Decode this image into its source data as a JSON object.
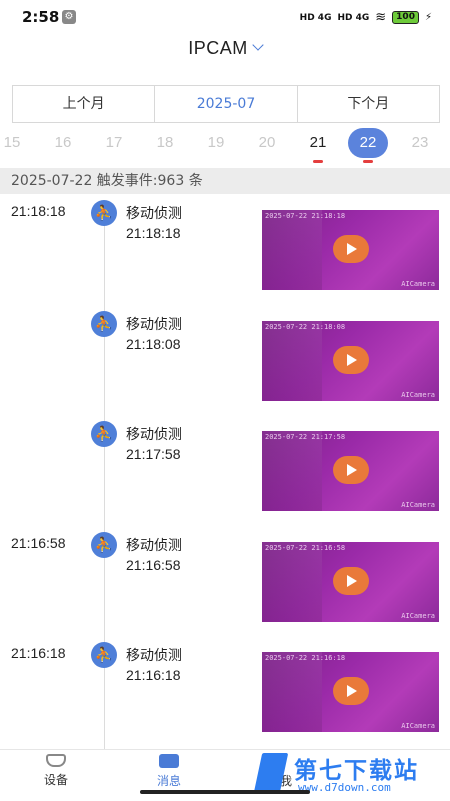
{
  "status_bar": {
    "time": "2:58",
    "wrench": "🔧",
    "net1": "HD 4G",
    "net2": "HD 4G",
    "battery": "100"
  },
  "header": {
    "title": "IPCAM"
  },
  "month_nav": {
    "prev": "上个月",
    "current": "2025-07",
    "next": "下个月"
  },
  "days": [
    "15",
    "16",
    "17",
    "18",
    "19",
    "20",
    "21",
    "22",
    "23"
  ],
  "selected_day": "22",
  "date_summary": "2025-07-22 触发事件:963 条",
  "events": [
    {
      "time": "21:18:18",
      "type": "移动侦测",
      "detail": "21:18:18",
      "stamp": "2025-07-22 21:18:18",
      "brand": "AICamera"
    },
    {
      "time": "",
      "type": "移动侦测",
      "detail": "21:18:08",
      "stamp": "2025-07-22 21:18:08",
      "brand": "AICamera"
    },
    {
      "time": "",
      "type": "移动侦测",
      "detail": "21:17:58",
      "stamp": "2025-07-22 21:17:58",
      "brand": "AICamera"
    },
    {
      "time": "21:16:58",
      "type": "移动侦测",
      "detail": "21:16:58",
      "stamp": "2025-07-22 21:16:58",
      "brand": "AICamera"
    },
    {
      "time": "21:16:18",
      "type": "移动侦测",
      "detail": "21:16:18",
      "stamp": "2025-07-22 21:16:18",
      "brand": "AICamera"
    }
  ],
  "bottom_nav": {
    "device": "设备",
    "message": "消息",
    "mine": "我"
  },
  "watermark": {
    "title": "第七下载站",
    "url": "www.d7down.com"
  },
  "colors": {
    "accent": "#4a7bd6",
    "selected_day": "#5b83dc",
    "day_mark": "#e43e3e",
    "play": "#e9793a"
  }
}
